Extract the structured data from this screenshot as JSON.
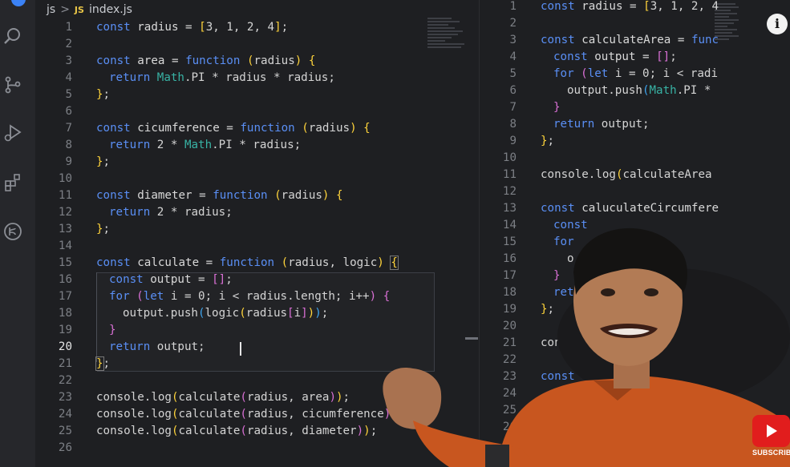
{
  "breadcrumb": {
    "folder": "js",
    "separator": ">",
    "file_badge": "JS",
    "file_name": "index.js"
  },
  "left_editor": {
    "line_numbers": [
      "1",
      "2",
      "3",
      "4",
      "5",
      "6",
      "7",
      "8",
      "9",
      "10",
      "11",
      "12",
      "13",
      "14",
      "15",
      "16",
      "17",
      "18",
      "19",
      "20",
      "21",
      "22",
      "23",
      "24",
      "25",
      "26"
    ],
    "active_line": "20"
  },
  "right_editor": {
    "line_numbers": [
      "1",
      "2",
      "3",
      "4",
      "5",
      "6",
      "7",
      "8",
      "9",
      "10",
      "11",
      "12",
      "13",
      "14",
      "15",
      "16",
      "17",
      "18",
      "19",
      "20",
      "21",
      "22",
      "23",
      "24",
      "25",
      "26"
    ]
  },
  "overlay": {
    "info_symbol": "i",
    "subscribe_label": "SUBSCRIBE"
  },
  "colors": {
    "keyword": "#5a8ff5",
    "type": "#38b2a4",
    "bracket": "#ffd43b",
    "background": "#1e1f22",
    "subscribe_red": "#e11d1d"
  },
  "icons": [
    "search-icon",
    "source-control-icon",
    "run-debug-icon",
    "extensions-icon",
    "remote-icon",
    "info-icon",
    "youtube-play-icon"
  ]
}
